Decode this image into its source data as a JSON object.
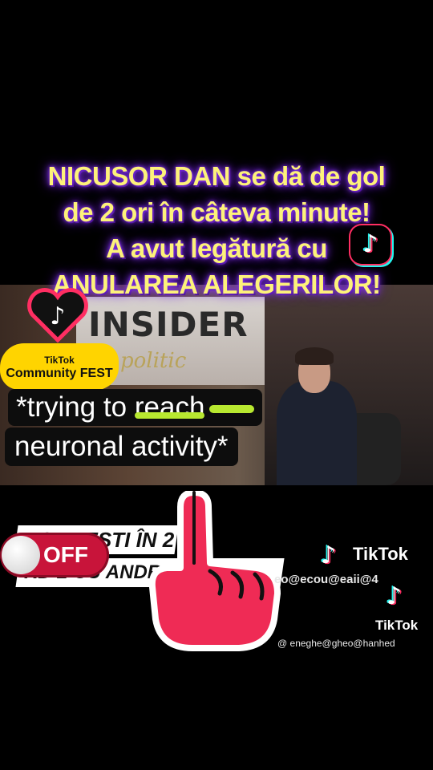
{
  "title": {
    "lines": [
      "NICUSOR DAN se dă de gol",
      "de 2 ori în câteva minute!",
      "A avut legătură cu",
      "ANULAREA ALEGERILOR!"
    ],
    "color": "#fdf27a",
    "glow": "#8d3cff"
  },
  "video": {
    "brand": "INSIDER",
    "brand_sub": "politic"
  },
  "fest_badge": {
    "small": "TikTok",
    "big": "Community FEST",
    "icon": "tiktok-heart-icon"
  },
  "caption": {
    "line1_prefix": "*trying to ",
    "line1_struck": "reach",
    "line2": "neuronal activity*",
    "highlight": "#b8e830"
  },
  "overlay_strip": {
    "line1": "BOIL, EȘTI ÎN 2",
    "line2": "RD 2 CU ANDR"
  },
  "toggle": {
    "label": "OFF",
    "color": "#c8143a"
  },
  "finger": {
    "icon": "pointing-finger-icon",
    "color": "#ef2b55"
  },
  "watermark": {
    "brand": "TikTok",
    "user1": "eo@ecou@eaii@4",
    "brand2": "TikTok",
    "user2": "@ eneghe@gheo@hanhed"
  }
}
